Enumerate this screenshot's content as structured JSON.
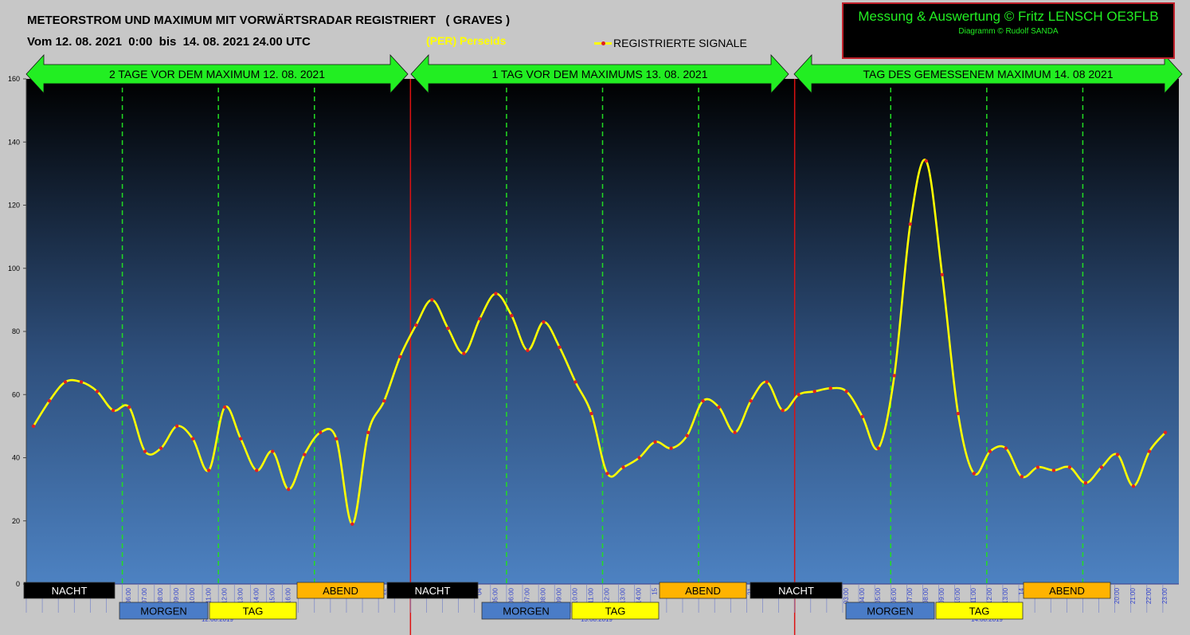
{
  "header": {
    "title": "METEORSTROM UND MAXIMUM MIT VORWÄRTSRADAR REGISTRIERT   ( GRAVES )",
    "subtitle": "Vom 12. 08. 2021  0:00  bis  14. 08. 2021 24.00 UTC",
    "shower": "(PER) Perseids",
    "legend_label": "REGISTRIERTE SIGNALE"
  },
  "credit": {
    "main": "Messung & Auswertung © Fritz LENSCH OE3FLB",
    "sub": "Diagramm © Rudolf SANDA"
  },
  "colors": {
    "line": "#ffff00",
    "marker": "#e02020",
    "day_banner": "#22ee22",
    "plot_top": "#000000",
    "plot_bottom": "#4d82c2",
    "day_divider": "#dd1111",
    "guide": "#22dd22",
    "nacht": "#000000",
    "morgen": "#4a7cc7",
    "tag": "#ffff00",
    "abend": "#ffb300",
    "hour_label": "#3344cc"
  },
  "chart_data": {
    "type": "line",
    "title": "METEORSTROM UND MAXIMUM MIT VORWÄRTSRADAR REGISTRIERT   ( GRAVES )",
    "xlabel": "",
    "ylabel": "",
    "ylim": [
      0,
      160
    ],
    "yticks": [
      0,
      20,
      40,
      60,
      80,
      100,
      120,
      140,
      160
    ],
    "grid": false,
    "legend": "top-center",
    "hour_labels": [
      "00",
      "01",
      "02",
      "03",
      "04",
      "05",
      "06:00",
      "07:00",
      "08:00",
      "09:00",
      "10:00",
      "11:00",
      "12:00",
      "13:00",
      "14:00",
      "15:00",
      "16:00",
      "17",
      "18",
      "19",
      "20",
      "21",
      "22",
      "23",
      "00",
      "01",
      "02",
      "03",
      "04",
      "05:00",
      "06:00",
      "07:00",
      "08:00",
      "09:00",
      "10:00",
      "11:00",
      "12:00",
      "13:00",
      "14:00",
      "15",
      "16",
      "17",
      "18",
      "19",
      "20",
      "21",
      "22",
      "23",
      "00",
      "01",
      "02",
      "03:00",
      "04:00",
      "05:00",
      "06:00",
      "07:00",
      "08:00",
      "09:00",
      "10:00",
      "11:00",
      "12:00",
      "13:00",
      "14",
      "15",
      "16",
      "17",
      "18",
      "19",
      "20:00",
      "21:00",
      "22:00",
      "23:00"
    ],
    "date_labels": [
      "12.08.2019",
      "13.08.2019",
      "14.08.2019"
    ],
    "series": [
      {
        "name": "REGISTRIERTE SIGNALE",
        "values": [
          50,
          58,
          64,
          64,
          61,
          55,
          56,
          42,
          43,
          50,
          46,
          36,
          56,
          46,
          36,
          42,
          30,
          41,
          48,
          46,
          19,
          48,
          58,
          72,
          82,
          90,
          81,
          73,
          84,
          92,
          85,
          74,
          83,
          75,
          64,
          54,
          35,
          37,
          40,
          45,
          43,
          47,
          58,
          56,
          48,
          58,
          64,
          55,
          60,
          61,
          62,
          61,
          53,
          43,
          66,
          114,
          134,
          98,
          54,
          35,
          42,
          43,
          34,
          37,
          36,
          37,
          32,
          37,
          41,
          31,
          42,
          48
        ]
      }
    ],
    "day_banners": [
      "2 TAGE VOR DEM MAXIMUM  12. 08. 2021",
      "1 TAG VOR DEM MAXIMUMS 13. 08. 2021",
      "TAG DES GEMESSENEM MAXIMUM 14. 08 2021"
    ],
    "period_labels": {
      "nacht": "NACHT",
      "morgen": "MORGEN",
      "tag": "TAG",
      "abend": "ABEND"
    }
  }
}
